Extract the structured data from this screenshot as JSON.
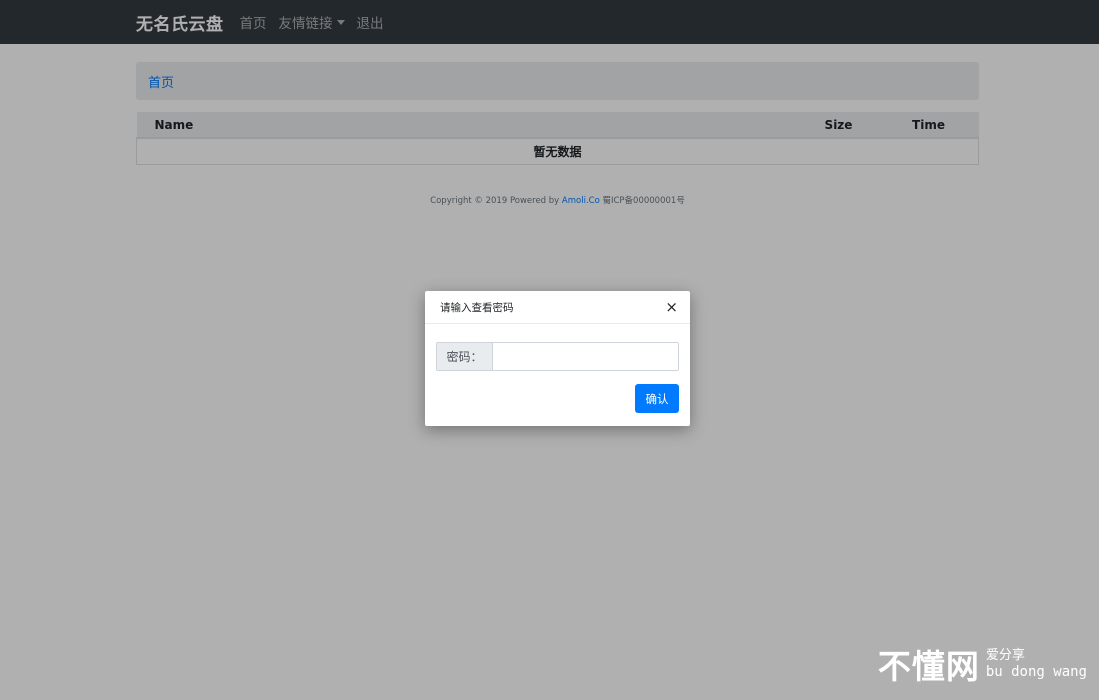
{
  "navbar": {
    "brand": "无名氏云盘",
    "links": [
      {
        "label": "首页"
      },
      {
        "label": "友情链接"
      },
      {
        "label": "退出"
      }
    ]
  },
  "breadcrumb": {
    "home": "首页"
  },
  "table": {
    "columns": {
      "name": "Name",
      "size": "Size",
      "time": "Time"
    },
    "empty_text": "暂无数据"
  },
  "footer": {
    "copyright": "Copyright © 2019 Powered by",
    "powered_link": "Amoli.Co",
    "icp": "蜀ICP备00000001号"
  },
  "modal": {
    "title": "请输入查看密码",
    "close": "×",
    "password_label": "密码：",
    "password_value": "",
    "confirm_label": "确认"
  },
  "watermark": {
    "main": "不懂网",
    "tagline": "爱分享",
    "pinyin": "bu dong wang"
  }
}
